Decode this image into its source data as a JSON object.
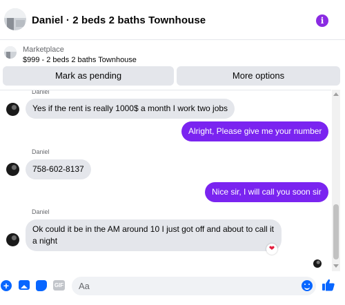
{
  "header": {
    "title": "Daniel · 2 beds 2 baths Townhouse",
    "info_icon": "info-icon"
  },
  "listing": {
    "source": "Marketplace",
    "title": "$999 - 2 beds 2 baths Townhouse"
  },
  "actions": {
    "pending_label": "Mark as pending",
    "more_label": "More options"
  },
  "messages": {
    "m0_sender": "Daniel",
    "m1_text": "Yes if the rent is really 1000$ a month I work two jobs",
    "m2_text": "Alright, Please give me your number",
    "m3_sender": "Daniel",
    "m3_text": "758-602-8137",
    "m4_text": "Nice sir, I will call you soon sir",
    "m5_sender": "Daniel",
    "m5_text": "Ok could it be in the AM around 10 I just got off and about to call it a night",
    "m5_reaction": "❤"
  },
  "composer": {
    "placeholder": "Aa",
    "gif_label": "GIF",
    "plus_glyph": "+"
  },
  "colors": {
    "accent": "#7a24f0",
    "brand": "#0866ff",
    "bubble_in": "#e4e6eb",
    "reaction": "#e41e3f"
  }
}
